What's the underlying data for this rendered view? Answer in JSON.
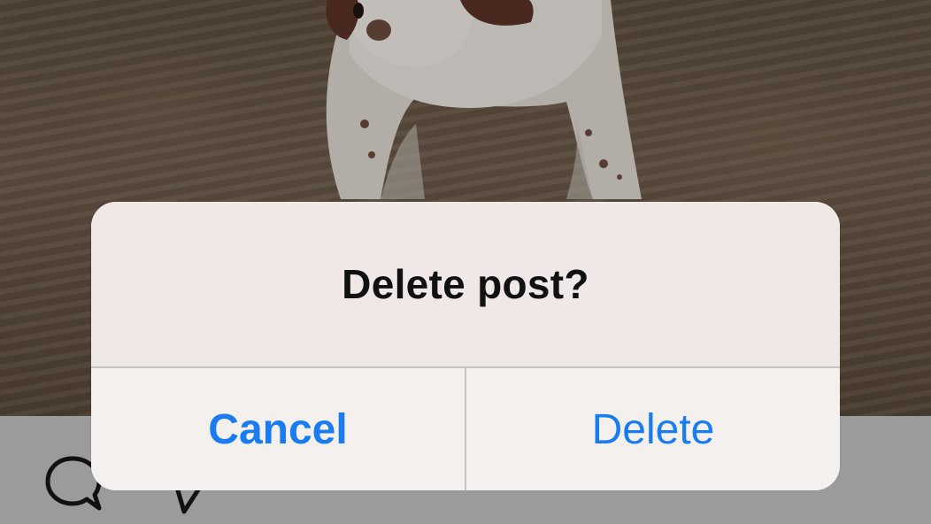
{
  "alert": {
    "title": "Delete post?",
    "buttons": {
      "cancel_label": "Cancel",
      "delete_label": "Delete"
    }
  },
  "toolbar": {
    "icons": [
      "comment-icon",
      "share-icon"
    ]
  },
  "colors": {
    "accent": "#1a7cf2",
    "title_text": "#111111",
    "alert_background": "#efe8e6",
    "toolbar_background": "#9b9b9b"
  }
}
